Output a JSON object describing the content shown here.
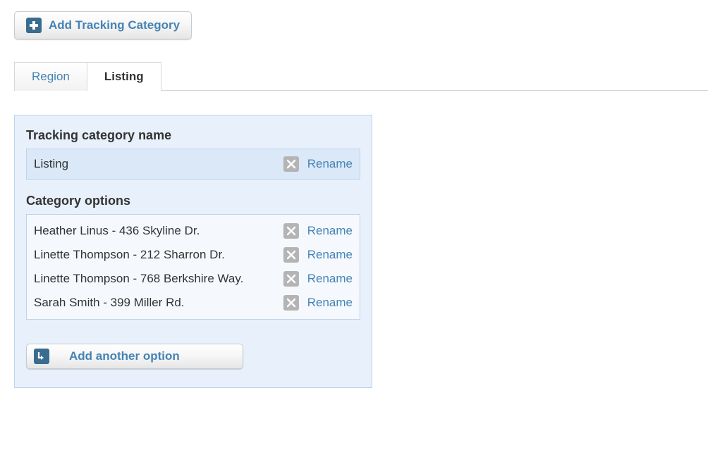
{
  "addCategoryBtn": "Add Tracking Category",
  "tabs": [
    {
      "label": "Region",
      "active": false
    },
    {
      "label": "Listing",
      "active": true
    }
  ],
  "categoryNameHeading": "Tracking category name",
  "categoryName": "Listing",
  "renameLabel": "Rename",
  "optionsHeading": "Category options",
  "options": [
    {
      "label": "Heather Linus - 436 Skyline Dr.",
      "rename": "Rename"
    },
    {
      "label": "Linette Thompson - 212 Sharron Dr.",
      "rename": "Rename"
    },
    {
      "label": "Linette Thompson - 768 Berkshire Way.",
      "rename": "Rename"
    },
    {
      "label": "Sarah Smith - 399 Miller Rd.",
      "rename": "Rename"
    }
  ],
  "addAnotherBtn": "Add another option"
}
